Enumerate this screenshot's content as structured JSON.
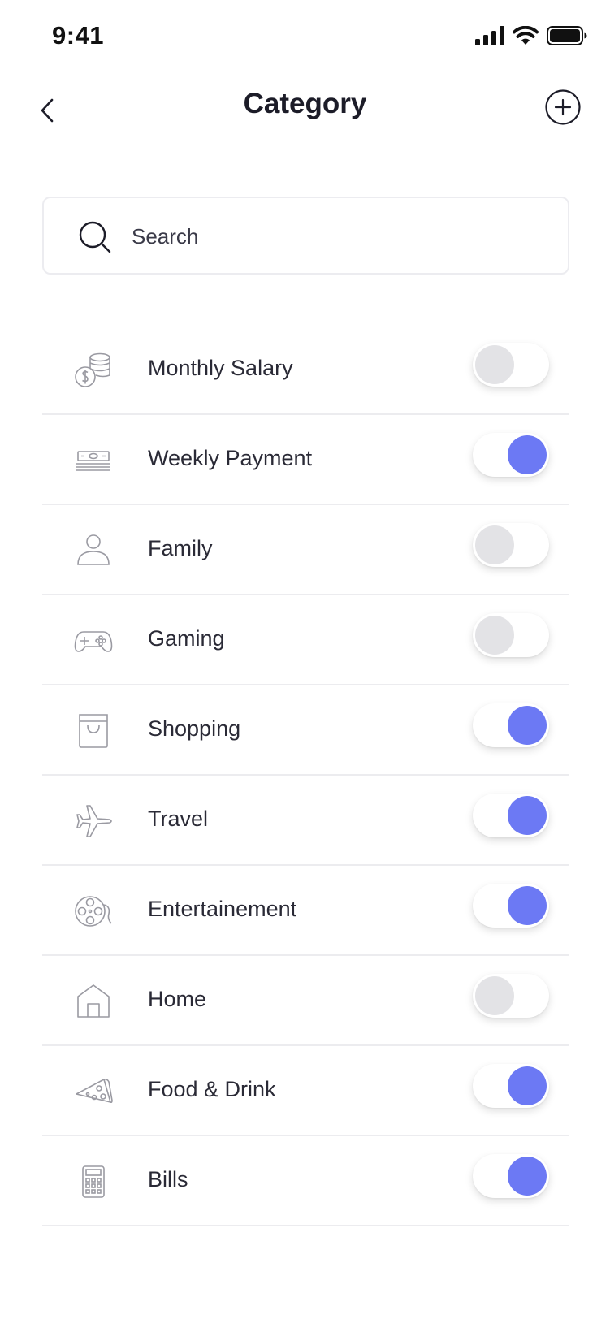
{
  "status_bar": {
    "time": "9:41",
    "icons": [
      "cellular-signal-icon",
      "wifi-icon",
      "battery-icon"
    ]
  },
  "nav": {
    "title": "Category",
    "back_icon": "chevron-left-icon",
    "add_icon": "plus-circle-icon"
  },
  "search": {
    "placeholder": "Search",
    "value": "",
    "icon": "search-icon"
  },
  "colors": {
    "accent": "#6c79f4",
    "toggle_off_knob": "#e3e3e6",
    "icon_stroke": "#9a9aa2",
    "divider": "#ececef"
  },
  "categories": [
    {
      "label": "Monthly Salary",
      "icon": "coins-icon",
      "enabled": false
    },
    {
      "label": "Weekly Payment",
      "icon": "cash-stack-icon",
      "enabled": true
    },
    {
      "label": "Family",
      "icon": "person-icon",
      "enabled": false
    },
    {
      "label": "Gaming",
      "icon": "gamepad-icon",
      "enabled": false
    },
    {
      "label": "Shopping",
      "icon": "shopping-bag-icon",
      "enabled": true
    },
    {
      "label": "Travel",
      "icon": "airplane-icon",
      "enabled": true
    },
    {
      "label": "Entertainement",
      "icon": "film-reel-icon",
      "enabled": true
    },
    {
      "label": "Home",
      "icon": "house-icon",
      "enabled": false
    },
    {
      "label": "Food & Drink",
      "icon": "pizza-icon",
      "enabled": true
    },
    {
      "label": "Bills",
      "icon": "calculator-icon",
      "enabled": true
    }
  ]
}
